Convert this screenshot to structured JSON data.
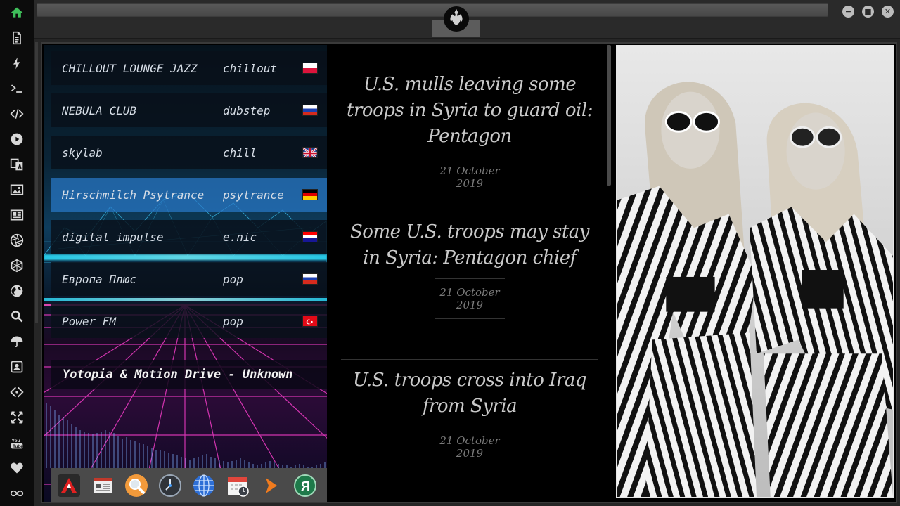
{
  "sidebar": {
    "icons": [
      "home-icon",
      "document-icon",
      "lightning-icon",
      "terminal-icon",
      "code-icon",
      "play-icon",
      "translate-icon",
      "image-icon",
      "news-icon",
      "aperture-icon",
      "hexagon-icon",
      "globe-icon",
      "search-icon",
      "umbrella-icon",
      "contact-icon",
      "tag-icon",
      "fullscreen-icon",
      "youtube-icon",
      "heart-icon",
      "infinity-icon"
    ]
  },
  "window": {
    "logo": "rebel-alliance-logo",
    "minimize": "−",
    "maximize": "■",
    "close": "✕"
  },
  "radio": {
    "stations": [
      {
        "name": "CHILLOUT LOUNGE JAZZ",
        "genre": "chillout",
        "flag": "poland"
      },
      {
        "name": "NEBULA CLUB",
        "genre": "dubstep",
        "flag": "russia"
      },
      {
        "name": "skylab",
        "genre": "chill",
        "flag": "uk"
      },
      {
        "name": "Hirschmilch Psytrance",
        "genre": "psytrance",
        "flag": "germany"
      },
      {
        "name": "digital impulse",
        "genre": "e.nic",
        "flag": "croatia"
      },
      {
        "name": "Европа Плюс",
        "genre": "pop",
        "flag": "russia"
      },
      {
        "name": "Power FM",
        "genre": "pop",
        "flag": "turkey"
      }
    ],
    "selected_index": 3,
    "now_playing": "Yotopia & Motion Drive - Unknown"
  },
  "dock": {
    "icons": [
      "artix-icon",
      "newspaper-icon",
      "magnifier-icon",
      "clock-icon",
      "web-browser-icon",
      "calendar-icon",
      "arrow-icon",
      "yandex-icon"
    ]
  },
  "news": {
    "items": [
      {
        "title": "U.S. mulls leaving some troops in Syria to guard oil: Pentagon",
        "date": "21 October 2019"
      },
      {
        "title": "Some U.S. troops may stay in Syria: Pentagon chief",
        "date": "21 October 2019"
      },
      {
        "title": "U.S. troops cross into Iraq from Syria",
        "date": "21 October 2019"
      }
    ]
  },
  "colors": {
    "accent_home": "#3fbf5a",
    "selected_station": "#2878c8"
  }
}
